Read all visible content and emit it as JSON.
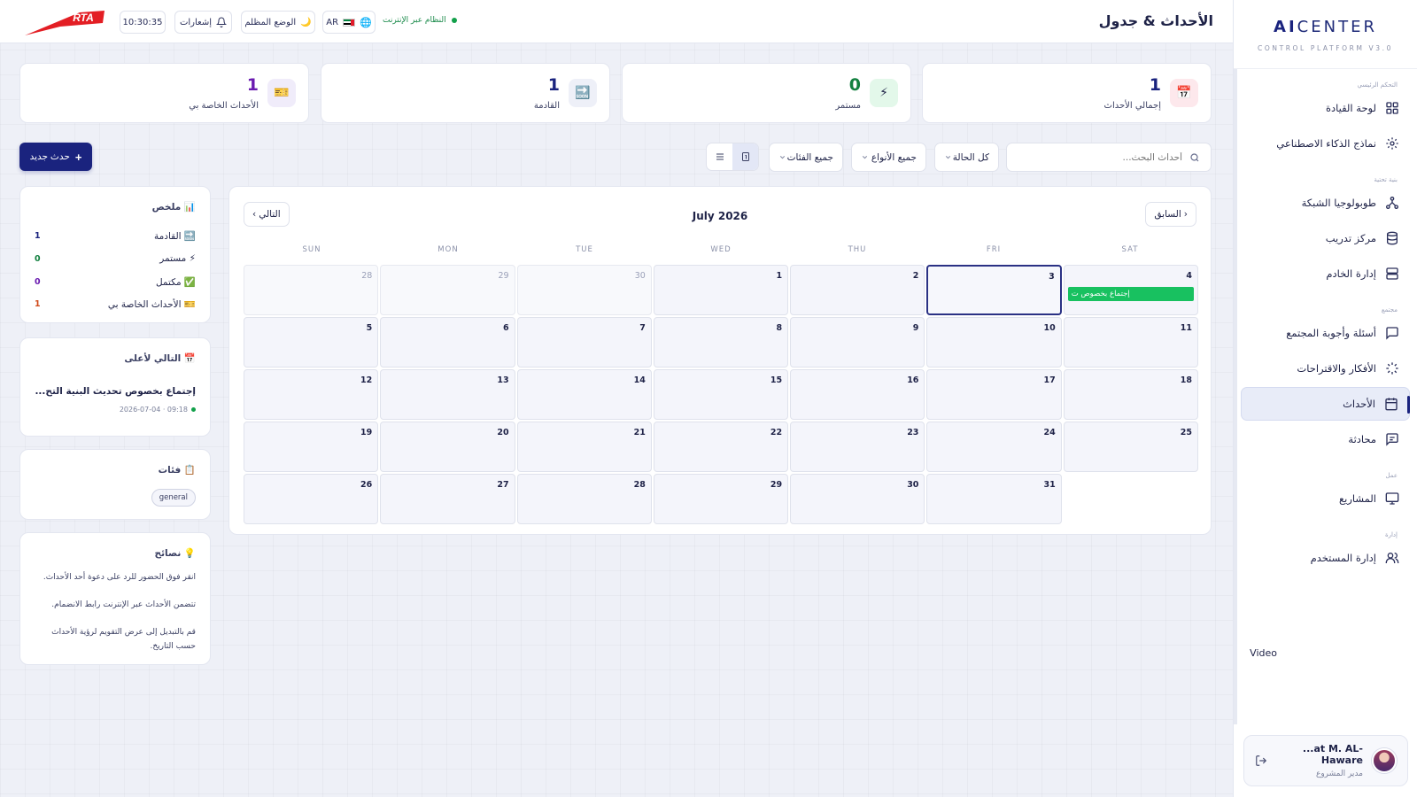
{
  "header": {
    "title": "الأحداث & جدول",
    "system_status": "النظام عبر الإنترنت",
    "language": "AR",
    "theme_toggle": "الوضع المظلم",
    "notifications": "إشعارات",
    "clock": "10:30:35",
    "logo_text": "RTA"
  },
  "sidebar": {
    "brand_ai": "AI",
    "brand_center": "CENTER",
    "brand_subtitle": "CONTROL PLATFORM V3.0",
    "sections": {
      "main": "التحكم الرئيسي",
      "infrastructure": "بنية تحتية",
      "community": "مجتمع",
      "work": "عمل",
      "admin": "إدارة"
    },
    "items": [
      {
        "label": "لوحة القيادة",
        "icon": "dashboard-icon"
      },
      {
        "label": "نماذج الذكاء الاصطناعي",
        "icon": "ai-models-icon"
      },
      {
        "label": "طوبولوجيا الشبكة",
        "icon": "network-icon"
      },
      {
        "label": "مركز تدريب",
        "icon": "database-icon"
      },
      {
        "label": "إدارة الخادم",
        "icon": "server-icon"
      },
      {
        "label": "أسئلة وأجوبة المجتمع",
        "icon": "chat-icon"
      },
      {
        "label": "الأفكار والاقتراحات",
        "icon": "ideas-icon"
      },
      {
        "label": "الأحداث",
        "icon": "calendar-icon"
      },
      {
        "label": "محادثة",
        "icon": "message-icon"
      },
      {
        "label": "المشاريع",
        "icon": "monitor-icon"
      },
      {
        "label": "إدارة المستخدم",
        "icon": "users-icon"
      }
    ],
    "video_label": "Video",
    "user": {
      "name": "...at M. AL-Haware",
      "role": "مدير المشروع"
    }
  },
  "stats": [
    {
      "label": "إجمالي الأحداث",
      "value": "1",
      "icon": "📅",
      "color": "#1a237e"
    },
    {
      "label": "مستمر",
      "value": "0",
      "icon": "⚡",
      "color": "#12803f"
    },
    {
      "label": "القادمة",
      "value": "1",
      "icon": "🔜",
      "color": "#1a237e"
    },
    {
      "label": "الأحداث الخاصة بي",
      "value": "1",
      "icon": "🎫",
      "color": "#6a1bb0"
    }
  ],
  "toolbar": {
    "search_placeholder": "أحداث البحث...",
    "status_filter": "كل الحالة",
    "type_filter": "جميع الأنواع",
    "category_filter": "جميع الفئات",
    "new_event": "حدث جديد"
  },
  "calendar": {
    "month_title": "July 2026",
    "prev_label": "السابق",
    "next_label": "التالي",
    "weekdays": [
      "SUN",
      "MON",
      "TUE",
      "WED",
      "THU",
      "FRI",
      "SAT"
    ],
    "weeks": [
      [
        {
          "d": "28",
          "o": true
        },
        {
          "d": "29",
          "o": true
        },
        {
          "d": "30",
          "o": true
        },
        {
          "d": "1"
        },
        {
          "d": "2"
        },
        {
          "d": "3",
          "today": true
        },
        {
          "d": "4",
          "event": "إجتماع بخصوص ت"
        }
      ],
      [
        {
          "d": "5"
        },
        {
          "d": "6"
        },
        {
          "d": "7"
        },
        {
          "d": "8"
        },
        {
          "d": "9"
        },
        {
          "d": "10"
        },
        {
          "d": "11"
        }
      ],
      [
        {
          "d": "12"
        },
        {
          "d": "13"
        },
        {
          "d": "14"
        },
        {
          "d": "15"
        },
        {
          "d": "16"
        },
        {
          "d": "17"
        },
        {
          "d": "18"
        }
      ],
      [
        {
          "d": "19"
        },
        {
          "d": "20"
        },
        {
          "d": "21"
        },
        {
          "d": "22"
        },
        {
          "d": "23"
        },
        {
          "d": "24"
        },
        {
          "d": "25"
        }
      ],
      [
        {
          "d": "26"
        },
        {
          "d": "27"
        },
        {
          "d": "28"
        },
        {
          "d": "29"
        },
        {
          "d": "30"
        },
        {
          "d": "31"
        },
        {
          "d": ""
        }
      ]
    ]
  },
  "summary": {
    "title": "📊 ملخص",
    "rows": [
      {
        "label": "🔜 القادمة",
        "value": "1",
        "color": "#1a237e"
      },
      {
        "label": "⚡ مستمر",
        "value": "0",
        "color": "#12803f"
      },
      {
        "label": "✅ مكتمل",
        "value": "0",
        "color": "#6a1bb0"
      },
      {
        "label": "🎫 الأحداث الخاصة بي",
        "value": "1",
        "color": "#d04a1a"
      }
    ]
  },
  "next_up": {
    "title": "📅 التالي لأعلى",
    "event_title": "إجتماع بخصوص تحديث البنية التح...",
    "event_meta": "2026-07-04 · 09:18"
  },
  "categories": {
    "title": "📋 فئات",
    "tags": [
      "general"
    ]
  },
  "tips": {
    "title": "💡 نصائح",
    "items": [
      "انقر فوق الحضور للرد على دعوة أحد الأحداث.",
      "تتضمن الأحداث عبر الإنترنت رابط الانضمام.",
      "قم بالتبديل إلى عرض التقويم لرؤية الأحداث حسب التاريخ."
    ]
  },
  "colors": {
    "primary": "#1a237e",
    "event_green": "#18c160",
    "online_green": "#12a04a"
  }
}
